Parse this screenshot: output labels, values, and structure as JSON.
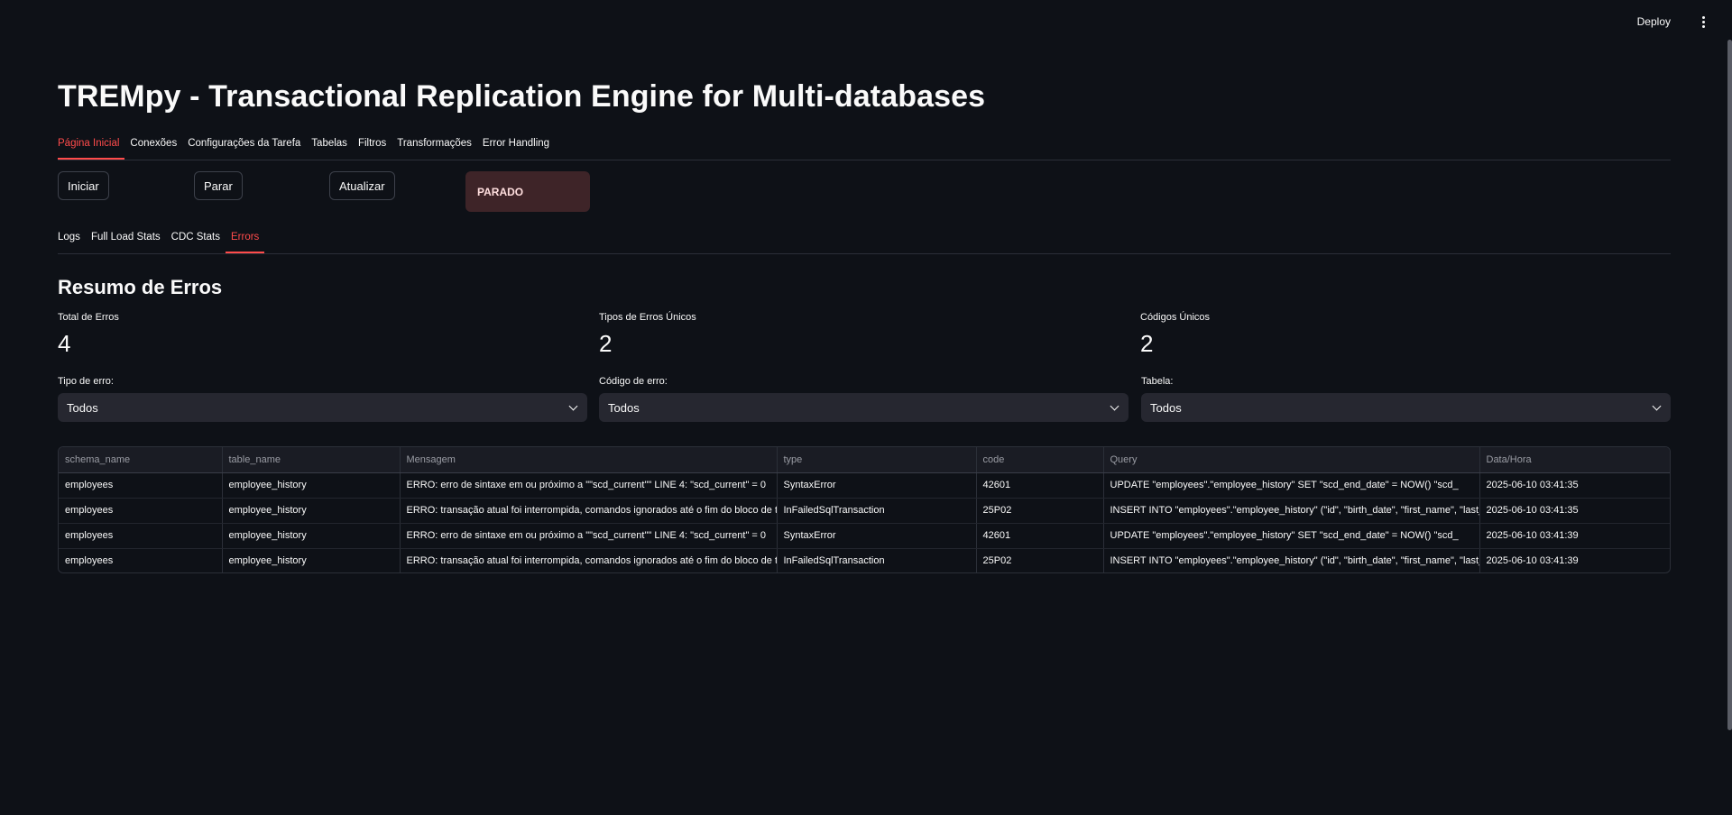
{
  "topbar": {
    "deploy_label": "Deploy",
    "menu_icon": "kebab-menu-icon"
  },
  "app_title": "TREMpy - Transactional Replication Engine for Multi-databases",
  "main_tabs": [
    {
      "label": "Página Inicial",
      "active": true
    },
    {
      "label": "Conexões",
      "active": false
    },
    {
      "label": "Configurações da Tarefa",
      "active": false
    },
    {
      "label": "Tabelas",
      "active": false
    },
    {
      "label": "Filtros",
      "active": false
    },
    {
      "label": "Transformações",
      "active": false
    },
    {
      "label": "Error Handling",
      "active": false
    }
  ],
  "controls": {
    "start_label": "Iniciar",
    "stop_label": "Parar",
    "refresh_label": "Atualizar",
    "status_text": "PARADO",
    "status_color": "#3e2428"
  },
  "sub_tabs": [
    {
      "label": "Logs",
      "active": false
    },
    {
      "label": "Full Load Stats",
      "active": false
    },
    {
      "label": "CDC Stats",
      "active": false
    },
    {
      "label": "Errors",
      "active": true
    }
  ],
  "section_title": "Resumo de Erros",
  "metrics": [
    {
      "label": "Total de Erros",
      "value": "4"
    },
    {
      "label": "Tipos de Erros Únicos",
      "value": "2"
    },
    {
      "label": "Códigos Únicos",
      "value": "2"
    }
  ],
  "filters": [
    {
      "label": "Tipo de erro:",
      "selected": "Todos"
    },
    {
      "label": "Código de erro:",
      "selected": "Todos"
    },
    {
      "label": "Tabela:",
      "selected": "Todos"
    }
  ],
  "table": {
    "columns": [
      "schema_name",
      "table_name",
      "Mensagem",
      "type",
      "code",
      "Query",
      "Data/Hora"
    ],
    "rows": [
      [
        "employees",
        "employee_history",
        "ERRO:  erro de sintaxe em ou próximo a \"\"scd_current\"\" LINE 4:          \"scd_current\" = 0",
        "SyntaxError",
        "42601",
        "    UPDATE \"employees\".\"employee_history\"        SET \"scd_end_date\" = NOW()          \"scd_",
        "2025-06-10 03:41:35"
      ],
      [
        "employees",
        "employee_history",
        "ERRO:  transação atual foi interrompida, comandos ignorados até o fim do bloco de trans",
        "InFailedSqlTransaction",
        "25P02",
        "    INSERT INTO \"employees\".\"employee_history\" (\"id\", \"birth_date\", \"first_name\", \"last_na",
        "2025-06-10 03:41:35"
      ],
      [
        "employees",
        "employee_history",
        "ERRO:  erro de sintaxe em ou próximo a \"\"scd_current\"\" LINE 4:          \"scd_current\" = 0",
        "SyntaxError",
        "42601",
        "    UPDATE \"employees\".\"employee_history\"        SET \"scd_end_date\" = NOW()          \"scd_",
        "2025-06-10 03:41:39"
      ],
      [
        "employees",
        "employee_history",
        "ERRO:  transação atual foi interrompida, comandos ignorados até o fim do bloco de trans",
        "InFailedSqlTransaction",
        "25P02",
        "    INSERT INTO \"employees\".\"employee_history\" (\"id\", \"birth_date\", \"first_name\", \"last_na",
        "2025-06-10 03:41:39"
      ]
    ]
  },
  "colors": {
    "background": "#0e1117",
    "accent": "#ff4b4b",
    "input_bg": "#262730"
  }
}
